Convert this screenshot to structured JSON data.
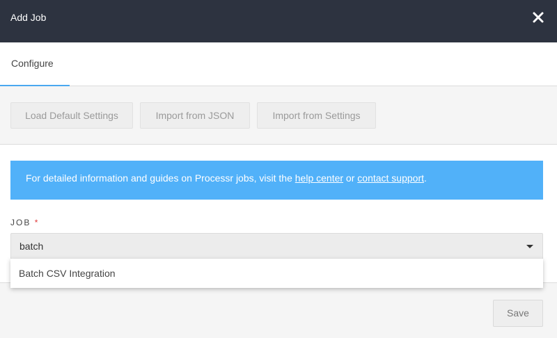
{
  "header": {
    "title": "Add Job",
    "close_icon": "close-icon"
  },
  "tabs": [
    {
      "label": "Configure",
      "active": true
    }
  ],
  "toolbar": {
    "load_default_label": "Load Default Settings",
    "import_json_label": "Import from JSON",
    "import_settings_label": "Import from Settings"
  },
  "banner": {
    "text_before": "For detailed information and guides on Processr jobs, visit the ",
    "help_link": "help center",
    "text_middle": " or ",
    "support_link": "contact support",
    "text_after": "."
  },
  "job_field": {
    "label": "JOB",
    "required_marker": "*",
    "value": "batch",
    "caret_icon": "caret-down-icon",
    "options": [
      "Batch CSV Integration"
    ]
  },
  "footer": {
    "save_label": "Save"
  },
  "colors": {
    "titlebar_bg": "#2d3340",
    "accent": "#4aa8f0",
    "banner_bg": "#51b1f9",
    "required": "#e03a3a"
  }
}
